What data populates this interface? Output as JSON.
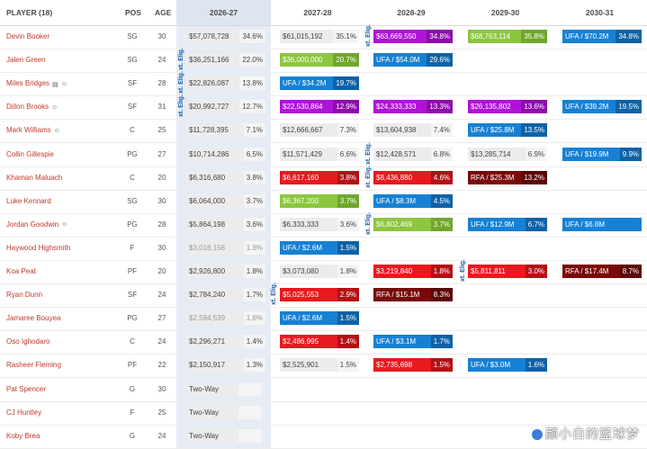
{
  "header": {
    "player": "PLAYER (18)",
    "pos": "POS",
    "age": "AGE",
    "seasons": [
      "2026-27",
      "2027-28",
      "2028-29",
      "2029-30",
      "2030-31"
    ]
  },
  "ext_label": "xt. Elig.",
  "colors": {
    "green": "#8cc63f",
    "purple": "#b013d8",
    "blue": "#1681d4",
    "red": "#e8191f",
    "dark_red": "#7a0a0a"
  },
  "rows": [
    {
      "name": "Devin Booker",
      "pos": "SG",
      "age": "30",
      "icons": [],
      "c": [
        {
          "t": "std",
          "a": "$57,078,728",
          "p": "34.6%"
        },
        {
          "t": "std",
          "a": "$61,015,192",
          "p": "35.1%"
        },
        {
          "t": "purple",
          "a": "$63,669,550",
          "p": "34.8%"
        },
        {
          "t": "green",
          "a": "$68,763,114",
          "p": "35.8%"
        },
        {
          "t": "blue",
          "a": "UFA / $70.2M",
          "p": "34.8%"
        }
      ]
    },
    {
      "name": "Jalen Green",
      "pos": "SG",
      "age": "24",
      "icons": [],
      "c": [
        {
          "t": "std",
          "a": "$36,251,166",
          "p": "22.0%"
        },
        {
          "t": "green",
          "a": "$36,000,000",
          "p": "20.7%"
        },
        {
          "t": "blue",
          "a": "UFA / $54.0M",
          "p": "29.6%"
        },
        null,
        null
      ]
    },
    {
      "name": "Miles Bridges",
      "pos": "SF",
      "age": "28",
      "icons": [
        "doc-icon",
        "person-icon"
      ],
      "c": [
        {
          "t": "std",
          "a": "$22,826,087",
          "p": "13.8%"
        },
        {
          "t": "blue",
          "a": "UFA / $34.2M",
          "p": "19.7%"
        },
        null,
        null,
        null
      ]
    },
    {
      "name": "Dillon Brooks",
      "pos": "SF",
      "age": "31",
      "icons": [
        "person-icon"
      ],
      "c": [
        {
          "t": "std",
          "a": "$20,992,727",
          "p": "12.7%"
        },
        {
          "t": "purple",
          "a": "$22,530,864",
          "p": "12.9%"
        },
        {
          "t": "purple",
          "a": "$24,333,333",
          "p": "13.3%"
        },
        {
          "t": "purple",
          "a": "$26,135,802",
          "p": "13.6%"
        },
        {
          "t": "blue",
          "a": "UFA / $39.2M",
          "p": "19.5%"
        }
      ]
    },
    {
      "name": "Mark Williams",
      "pos": "C",
      "age": "25",
      "icons": [
        "person-icon"
      ],
      "c": [
        {
          "t": "std",
          "a": "$11,728,395",
          "p": "7.1%"
        },
        {
          "t": "std",
          "a": "$12,666,667",
          "p": "7.3%"
        },
        {
          "t": "std",
          "a": "$13,604,938",
          "p": "7.4%"
        },
        {
          "t": "blue",
          "a": "UFA / $25.8M",
          "p": "13.5%"
        },
        null
      ]
    },
    {
      "name": "Collin Gillespie",
      "pos": "PG",
      "age": "27",
      "icons": [],
      "c": [
        {
          "t": "std",
          "a": "$10,714,286",
          "p": "6.5%"
        },
        {
          "t": "std",
          "a": "$11,571,429",
          "p": "6.6%"
        },
        {
          "t": "std",
          "a": "$12,428,571",
          "p": "6.8%"
        },
        {
          "t": "std",
          "a": "$13,285,714",
          "p": "6.9%"
        },
        {
          "t": "blue",
          "a": "UFA / $19.9M",
          "p": "9.9%"
        }
      ]
    },
    {
      "name": "Khaman Maluach",
      "pos": "C",
      "age": "20",
      "icons": [],
      "c": [
        {
          "t": "std",
          "a": "$6,316,680",
          "p": "3.8%"
        },
        {
          "t": "red",
          "a": "$6,617,160",
          "p": "3.8%"
        },
        {
          "t": "red",
          "a": "$8,436,880",
          "p": "4.6%"
        },
        {
          "t": "dred",
          "a": "RFA / $25.3M",
          "p": "13.2%"
        },
        null
      ]
    },
    {
      "name": "Luke Kennard",
      "pos": "SG",
      "age": "30",
      "icons": [],
      "c": [
        {
          "t": "std",
          "a": "$6,064,000",
          "p": "3.7%"
        },
        {
          "t": "green",
          "a": "$6,367,200",
          "p": "3.7%"
        },
        {
          "t": "blue",
          "a": "UFA / $8.3M",
          "p": "4.5%"
        },
        null,
        null
      ]
    },
    {
      "name": "Jordan Goodwin",
      "pos": "PG",
      "age": "28",
      "icons": [
        "person-icon"
      ],
      "c": [
        {
          "t": "std",
          "a": "$5,864,198",
          "p": "3.6%"
        },
        {
          "t": "std",
          "a": "$6,333,333",
          "p": "3.6%"
        },
        {
          "t": "green",
          "a": "$6,802,469",
          "p": "3.7%"
        },
        {
          "t": "blue",
          "a": "UFA / $12.9M",
          "p": "6.7%"
        },
        {
          "t": "blue",
          "a": "UFA / $6.8M",
          "p": ""
        }
      ]
    },
    {
      "name": "Haywood Highsmith",
      "pos": "F",
      "age": "30",
      "icons": [],
      "c": [
        {
          "t": "std dim",
          "a": "$3,018,158",
          "p": "1.8%"
        },
        {
          "t": "blue",
          "a": "UFA / $2.6M",
          "p": "1.5%"
        },
        null,
        null,
        null
      ]
    },
    {
      "name": "Koa Peat",
      "pos": "PF",
      "age": "20",
      "icons": [],
      "c": [
        {
          "t": "std",
          "a": "$2,926,800",
          "p": "1.8%"
        },
        {
          "t": "std",
          "a": "$3,073,080",
          "p": "1.8%"
        },
        {
          "t": "red",
          "a": "$3,219,840",
          "p": "1.8%"
        },
        {
          "t": "red",
          "a": "$5,811,811",
          "p": "3.0%"
        },
        {
          "t": "dred",
          "a": "RFA / $17.4M",
          "p": "8.7%"
        }
      ]
    },
    {
      "name": "Ryan Dunn",
      "pos": "SF",
      "age": "24",
      "icons": [],
      "c": [
        {
          "t": "std",
          "a": "$2,784,240",
          "p": "1.7%"
        },
        {
          "t": "red",
          "a": "$5,025,553",
          "p": "2.9%"
        },
        {
          "t": "dred",
          "a": "RFA / $15.1M",
          "p": "8.3%"
        },
        null,
        null
      ]
    },
    {
      "name": "Jamaree Bouyea",
      "pos": "PG",
      "age": "27",
      "icons": [],
      "c": [
        {
          "t": "std dim",
          "a": "$2,584,539",
          "p": "1.6%"
        },
        {
          "t": "blue",
          "a": "UFA / $2.6M",
          "p": "1.5%"
        },
        null,
        null,
        null
      ]
    },
    {
      "name": "Oso Ighodaro",
      "pos": "C",
      "age": "24",
      "icons": [],
      "c": [
        {
          "t": "std",
          "a": "$2,296,271",
          "p": "1.4%"
        },
        {
          "t": "red",
          "a": "$2,486,995",
          "p": "1.4%"
        },
        {
          "t": "blue",
          "a": "UFA / $3.1M",
          "p": "1.7%"
        },
        null,
        null
      ]
    },
    {
      "name": "Rasheer Fleming",
      "pos": "PF",
      "age": "22",
      "icons": [],
      "c": [
        {
          "t": "std",
          "a": "$2,150,917",
          "p": "1.3%"
        },
        {
          "t": "std",
          "a": "$2,525,901",
          "p": "1.5%"
        },
        {
          "t": "red",
          "a": "$2,735,698",
          "p": "1.5%"
        },
        {
          "t": "blue",
          "a": "UFA / $3.0M",
          "p": "1.6%"
        },
        null
      ]
    },
    {
      "name": "Pat Spencer",
      "pos": "G",
      "age": "30",
      "icons": [],
      "c": [
        {
          "t": "twoway",
          "a": "Two-Way",
          "p": ""
        },
        null,
        null,
        null,
        null
      ]
    },
    {
      "name": "CJ Huntley",
      "pos": "F",
      "age": "25",
      "icons": [],
      "c": [
        {
          "t": "twoway",
          "a": "Two-Way",
          "p": ""
        },
        null,
        null,
        null,
        null
      ]
    },
    {
      "name": "Koby Brea",
      "pos": "G",
      "age": "24",
      "icons": [],
      "c": [
        {
          "t": "twoway",
          "a": "Two-Way",
          "p": ""
        },
        null,
        null,
        null,
        null
      ]
    }
  ],
  "watermark": "颜小白的篮球梦"
}
